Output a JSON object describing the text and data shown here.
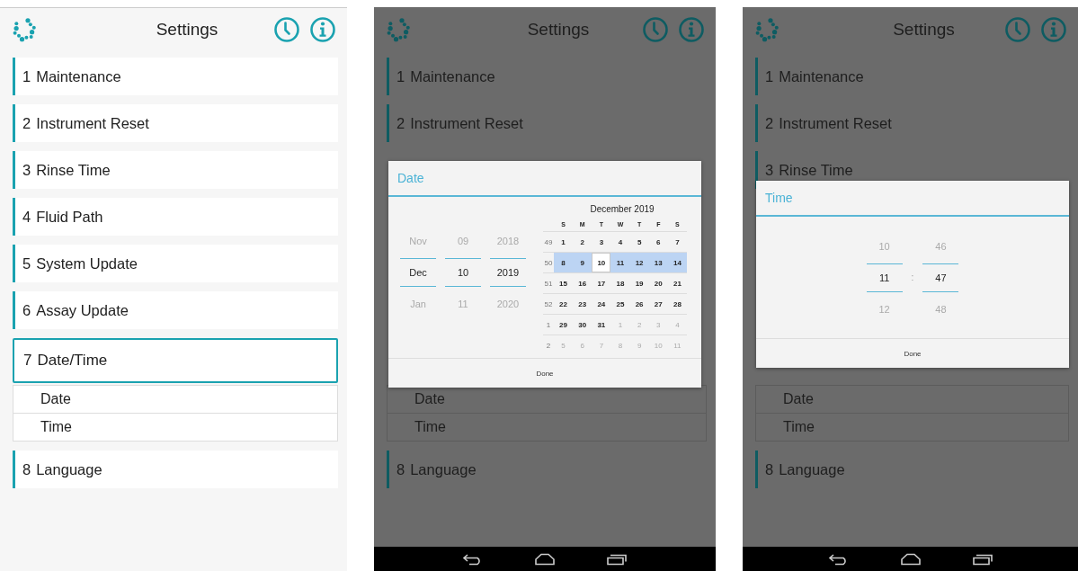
{
  "screens": [
    {
      "header": {
        "title": "Settings"
      },
      "items": [
        {
          "kind": "section",
          "number": "1",
          "label": "Maintenance",
          "expanded": false
        },
        {
          "kind": "section",
          "number": "2",
          "label": "Instrument Reset",
          "expanded": false
        },
        {
          "kind": "section",
          "number": "3",
          "label": "Rinse Time",
          "expanded": false
        },
        {
          "kind": "section",
          "number": "4",
          "label": "Fluid Path",
          "expanded": false
        },
        {
          "kind": "section",
          "number": "5",
          "label": "System Update",
          "expanded": false
        },
        {
          "kind": "section",
          "number": "6",
          "label": "Assay Update",
          "expanded": false
        },
        {
          "kind": "section",
          "number": "7",
          "label": "Date/Time",
          "expanded": true
        },
        {
          "kind": "subitem",
          "label": "Date"
        },
        {
          "kind": "subitem",
          "label": "Time"
        },
        {
          "kind": "section",
          "number": "8",
          "label": "Language",
          "expanded": false
        }
      ]
    },
    {
      "header": {
        "title": "Settings"
      },
      "nav_bar": true,
      "items_before": [
        {
          "kind": "section",
          "number": "1",
          "label": "Maintenance",
          "expanded": false
        },
        {
          "kind": "section",
          "number": "2",
          "label": "Instrument Reset",
          "expanded": false
        }
      ],
      "dialog": {
        "kind": "date",
        "title": "Date",
        "button": "Done",
        "spinners": [
          {
            "prev": "Nov",
            "value": "Dec",
            "next": "Jan"
          },
          {
            "prev": "09",
            "value": "10",
            "next": "11"
          },
          {
            "prev": "2018",
            "value": "2019",
            "next": "2020"
          }
        ],
        "calendar": {
          "month": "December 2019",
          "weekdays": [
            "S",
            "M",
            "T",
            "W",
            "T",
            "F",
            "S"
          ],
          "weeks": [
            {
              "number": "49",
              "selected": false,
              "days": [
                {
                  "label": "1",
                  "in_month": true,
                  "selected": false
                },
                {
                  "label": "2",
                  "in_month": true,
                  "selected": false
                },
                {
                  "label": "3",
                  "in_month": true,
                  "selected": false
                },
                {
                  "label": "4",
                  "in_month": true,
                  "selected": false
                },
                {
                  "label": "5",
                  "in_month": true,
                  "selected": false
                },
                {
                  "label": "6",
                  "in_month": true,
                  "selected": false
                },
                {
                  "label": "7",
                  "in_month": true,
                  "selected": false
                }
              ]
            },
            {
              "number": "50",
              "selected": true,
              "days": [
                {
                  "label": "8",
                  "in_month": true,
                  "selected": false
                },
                {
                  "label": "9",
                  "in_month": true,
                  "selected": false
                },
                {
                  "label": "10",
                  "in_month": true,
                  "selected": true
                },
                {
                  "label": "11",
                  "in_month": true,
                  "selected": false
                },
                {
                  "label": "12",
                  "in_month": true,
                  "selected": false
                },
                {
                  "label": "13",
                  "in_month": true,
                  "selected": false
                },
                {
                  "label": "14",
                  "in_month": true,
                  "selected": false
                }
              ]
            },
            {
              "number": "51",
              "selected": false,
              "days": [
                {
                  "label": "15",
                  "in_month": true,
                  "selected": false
                },
                {
                  "label": "16",
                  "in_month": true,
                  "selected": false
                },
                {
                  "label": "17",
                  "in_month": true,
                  "selected": false
                },
                {
                  "label": "18",
                  "in_month": true,
                  "selected": false
                },
                {
                  "label": "19",
                  "in_month": true,
                  "selected": false
                },
                {
                  "label": "20",
                  "in_month": true,
                  "selected": false
                },
                {
                  "label": "21",
                  "in_month": true,
                  "selected": false
                }
              ]
            },
            {
              "number": "52",
              "selected": false,
              "days": [
                {
                  "label": "22",
                  "in_month": true,
                  "selected": false
                },
                {
                  "label": "23",
                  "in_month": true,
                  "selected": false
                },
                {
                  "label": "24",
                  "in_month": true,
                  "selected": false
                },
                {
                  "label": "25",
                  "in_month": true,
                  "selected": false
                },
                {
                  "label": "26",
                  "in_month": true,
                  "selected": false
                },
                {
                  "label": "27",
                  "in_month": true,
                  "selected": false
                },
                {
                  "label": "28",
                  "in_month": true,
                  "selected": false
                }
              ]
            },
            {
              "number": "1",
              "selected": false,
              "days": [
                {
                  "label": "29",
                  "in_month": true,
                  "selected": false
                },
                {
                  "label": "30",
                  "in_month": true,
                  "selected": false
                },
                {
                  "label": "31",
                  "in_month": true,
                  "selected": false
                },
                {
                  "label": "1",
                  "in_month": false,
                  "selected": false
                },
                {
                  "label": "2",
                  "in_month": false,
                  "selected": false
                },
                {
                  "label": "3",
                  "in_month": false,
                  "selected": false
                },
                {
                  "label": "4",
                  "in_month": false,
                  "selected": false
                }
              ]
            },
            {
              "number": "2",
              "selected": false,
              "days": [
                {
                  "label": "5",
                  "in_month": false,
                  "selected": false
                },
                {
                  "label": "6",
                  "in_month": false,
                  "selected": false
                },
                {
                  "label": "7",
                  "in_month": false,
                  "selected": false
                },
                {
                  "label": "8",
                  "in_month": false,
                  "selected": false
                },
                {
                  "label": "9",
                  "in_month": false,
                  "selected": false
                },
                {
                  "label": "10",
                  "in_month": false,
                  "selected": false
                },
                {
                  "label": "11",
                  "in_month": false,
                  "selected": false
                }
              ]
            }
          ]
        }
      },
      "items_after": [
        {
          "kind": "subitem",
          "label": "Date"
        },
        {
          "kind": "subitem",
          "label": "Time"
        },
        {
          "kind": "section",
          "number": "8",
          "label": "Language",
          "expanded": false
        }
      ]
    },
    {
      "header": {
        "title": "Settings"
      },
      "nav_bar": true,
      "items_before": [
        {
          "kind": "section",
          "number": "1",
          "label": "Maintenance",
          "expanded": false
        },
        {
          "kind": "section",
          "number": "2",
          "label": "Instrument Reset",
          "expanded": false
        },
        {
          "kind": "section",
          "number": "3",
          "label": "Rinse Time",
          "expanded": false
        }
      ],
      "dialog": {
        "kind": "time",
        "title": "Time",
        "button": "Done",
        "separator": ":",
        "spinners": [
          {
            "prev": "10",
            "value": "11",
            "next": "12"
          },
          {
            "prev": "46",
            "value": "47",
            "next": "48"
          }
        ]
      },
      "items_after": [
        {
          "kind": "subitem",
          "label": "Date"
        },
        {
          "kind": "subitem",
          "label": "Time"
        },
        {
          "kind": "section",
          "number": "8",
          "label": "Language",
          "expanded": false
        }
      ]
    }
  ]
}
